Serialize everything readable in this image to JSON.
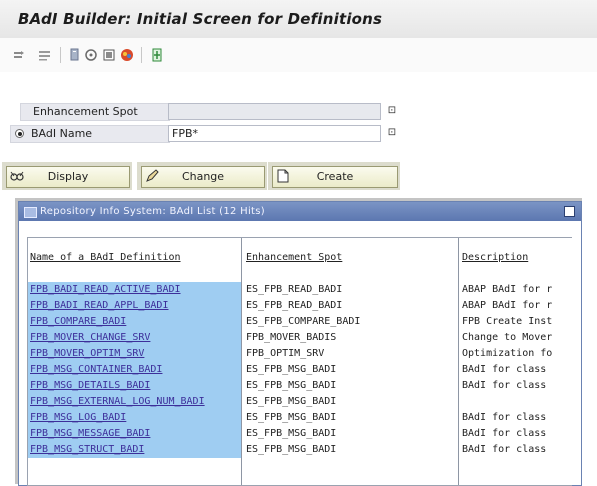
{
  "window": {
    "title": "BAdI Builder: Initial Screen for Definitions"
  },
  "toolbar": {
    "icons": [
      "back-icon",
      "display-list-icon",
      "other-object-icon",
      "where-used-icon",
      "check-icon",
      "info-icon"
    ]
  },
  "form": {
    "enhancement_spot": {
      "label": "Enhancement Spot",
      "value": ""
    },
    "badi_name": {
      "label": "BAdI Name",
      "value": "FPB*"
    },
    "f4_glyph": "⊡"
  },
  "buttons": {
    "display": "Display",
    "change": "Change",
    "create": "Create"
  },
  "dialog": {
    "title": "Repository Info System: BAdI List (12 Hits)",
    "columns": {
      "name": "Name of a BAdI Definition",
      "spot": "Enhancement Spot",
      "description": "Description"
    },
    "rows": [
      {
        "name": "FPB_BADI_READ_ACTIVE_BADI",
        "spot": "ES_FPB_READ_BADI",
        "description": "ABAP BAdI for r"
      },
      {
        "name": "FPB_BADI_READ_APPL_BADI",
        "spot": "ES_FPB_READ_BADI",
        "description": "ABAP BAdI for r"
      },
      {
        "name": "FPB_COMPARE_BADI",
        "spot": "ES_FPB_COMPARE_BADI",
        "description": "FPB Create Inst"
      },
      {
        "name": "FPB_MOVER_CHANGE_SRV",
        "spot": "FPB_MOVER_BADIS",
        "description": "Change to Mover"
      },
      {
        "name": "FPB_MOVER_OPTIM_SRV",
        "spot": "FPB_OPTIM_SRV",
        "description": "Optimization fo"
      },
      {
        "name": "FPB_MSG_CONTAINER_BADI",
        "spot": "ES_FPB_MSG_BADI",
        "description": "BAdI for class"
      },
      {
        "name": "FPB_MSG_DETAILS_BADI",
        "spot": "ES_FPB_MSG_BADI",
        "description": "BAdI for class"
      },
      {
        "name": "FPB_MSG_EXTERNAL_LOG_NUM_BADI",
        "spot": "ES_FPB_MSG_BADI",
        "description": ""
      },
      {
        "name": "FPB_MSG_LOG_BADI",
        "spot": "ES_FPB_MSG_BADI",
        "description": "BAdI for class"
      },
      {
        "name": "FPB_MSG_MESSAGE_BADI",
        "spot": "ES_FPB_MSG_BADI",
        "description": "BAdI for class"
      },
      {
        "name": "FPB_MSG_STRUCT_BADI",
        "spot": "ES_FPB_MSG_BADI",
        "description": "BAdI for class"
      }
    ]
  },
  "colors": {
    "selection": "#9fcdf2",
    "dialog_title": "#5c77b0",
    "button": "#ebebc9"
  }
}
